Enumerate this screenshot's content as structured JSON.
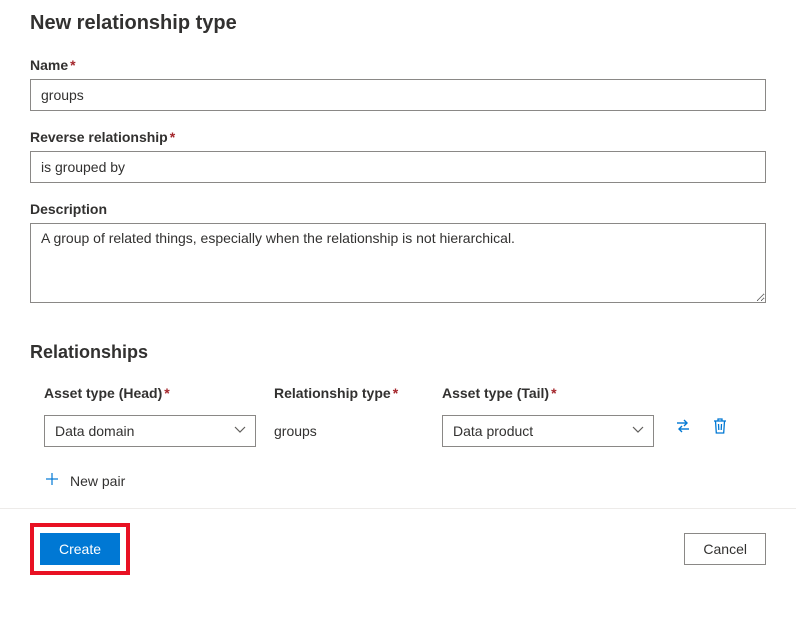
{
  "page": {
    "title": "New relationship type"
  },
  "fields": {
    "name": {
      "label": "Name",
      "value": "groups"
    },
    "reverse": {
      "label": "Reverse relationship",
      "value": "is grouped by"
    },
    "description": {
      "label": "Description",
      "value": "A group of related things, especially when the relationship is not hierarchical."
    }
  },
  "relationships": {
    "section_title": "Relationships",
    "columns": {
      "head": "Asset type (Head)",
      "type": "Relationship type",
      "tail": "Asset type (Tail)"
    },
    "row": {
      "head": "Data domain",
      "type": "groups",
      "tail": "Data product"
    },
    "new_pair_label": "New pair"
  },
  "footer": {
    "create": "Create",
    "cancel": "Cancel"
  }
}
